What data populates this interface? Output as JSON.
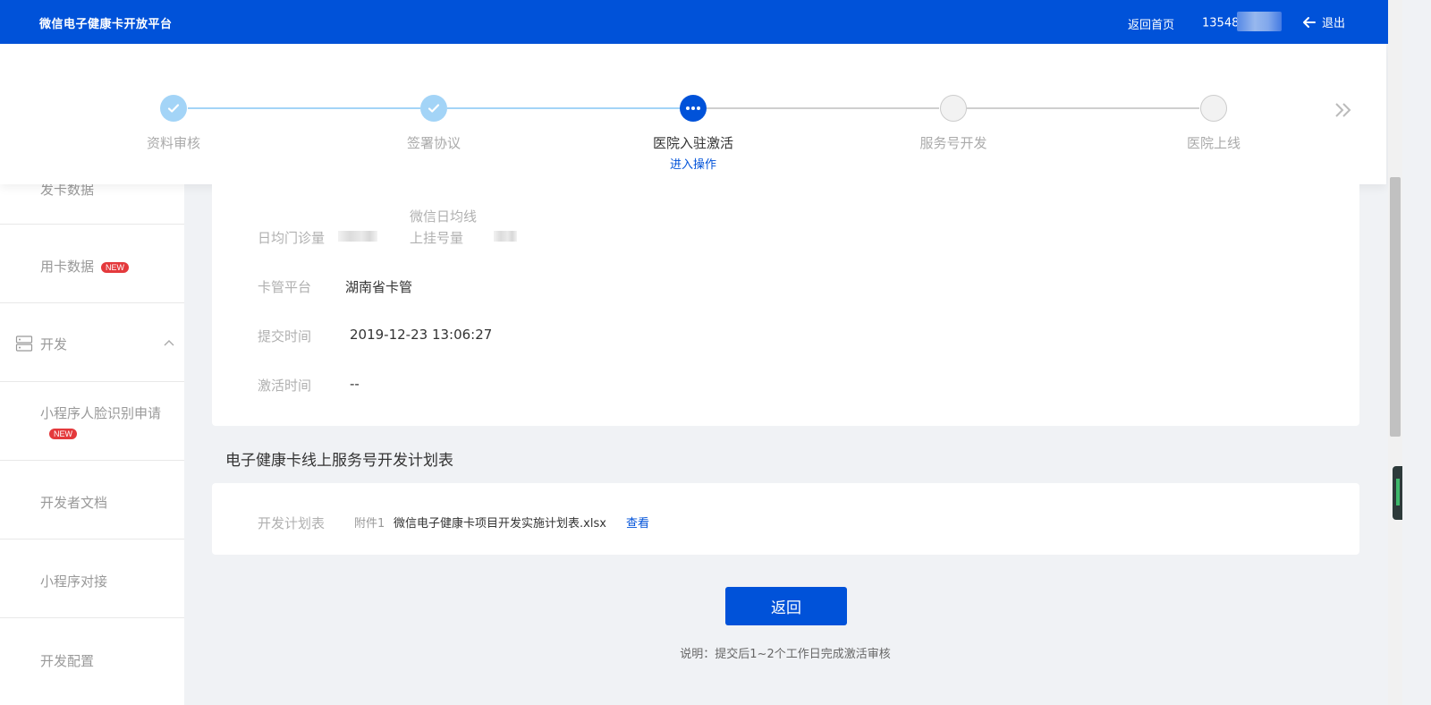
{
  "header": {
    "brand": "微信电子健康卡开放平台",
    "home_link": "返回首页",
    "phone": "13548",
    "logout": "退出"
  },
  "sidebar": {
    "items": [
      {
        "label": "发卡数据"
      },
      {
        "label": "用卡数据",
        "badge": "NEW"
      },
      {
        "label": "开发",
        "group": true
      },
      {
        "label": "小程序人脸识别申请",
        "badge": "NEW"
      },
      {
        "label": "开发者文档"
      },
      {
        "label": "小程序对接"
      },
      {
        "label": "开发配置"
      }
    ]
  },
  "steps": [
    {
      "label": "资料审核",
      "status": "done"
    },
    {
      "label": "签署协议",
      "status": "done"
    },
    {
      "label": "医院入驻激活",
      "status": "active",
      "sub": "进入操作"
    },
    {
      "label": "服务号开发",
      "status": "todo"
    },
    {
      "label": "医院上线",
      "status": "todo"
    }
  ],
  "info": {
    "daily_outpatient_label": "日均门诊量",
    "wechat_daily_label_1": "微信日均线",
    "wechat_daily_label_2": "上挂号量",
    "card_platform_label": "卡管平台",
    "card_platform_value": "湖南省卡管",
    "submit_time_label": "提交时间",
    "submit_time_value": "2019-12-23 13:06:27",
    "activate_time_label": "激活时间",
    "activate_time_value": "--"
  },
  "plan": {
    "section_title": "电子健康卡线上服务号开发计划表",
    "label": "开发计划表",
    "attach_label": "附件1",
    "file_name": "微信电子健康卡项目开发实施计划表.xlsx",
    "view_link": "查看"
  },
  "actions": {
    "back_button": "返回",
    "note": "说明：提交后1~2个工作日完成激活审核"
  },
  "colors": {
    "primary": "#0052d9",
    "done": "#a3d4f7",
    "badge": "#e4393c"
  }
}
